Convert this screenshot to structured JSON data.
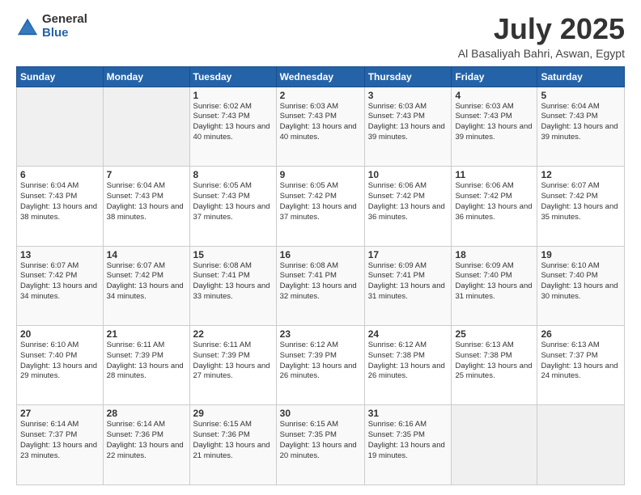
{
  "logo": {
    "general": "General",
    "blue": "Blue"
  },
  "title": "July 2025",
  "location": "Al Basaliyah Bahri, Aswan, Egypt",
  "days_of_week": [
    "Sunday",
    "Monday",
    "Tuesday",
    "Wednesday",
    "Thursday",
    "Friday",
    "Saturday"
  ],
  "weeks": [
    [
      {
        "day": "",
        "info": ""
      },
      {
        "day": "",
        "info": ""
      },
      {
        "day": "1",
        "info": "Sunrise: 6:02 AM\nSunset: 7:43 PM\nDaylight: 13 hours and 40 minutes."
      },
      {
        "day": "2",
        "info": "Sunrise: 6:03 AM\nSunset: 7:43 PM\nDaylight: 13 hours and 40 minutes."
      },
      {
        "day": "3",
        "info": "Sunrise: 6:03 AM\nSunset: 7:43 PM\nDaylight: 13 hours and 39 minutes."
      },
      {
        "day": "4",
        "info": "Sunrise: 6:03 AM\nSunset: 7:43 PM\nDaylight: 13 hours and 39 minutes."
      },
      {
        "day": "5",
        "info": "Sunrise: 6:04 AM\nSunset: 7:43 PM\nDaylight: 13 hours and 39 minutes."
      }
    ],
    [
      {
        "day": "6",
        "info": "Sunrise: 6:04 AM\nSunset: 7:43 PM\nDaylight: 13 hours and 38 minutes."
      },
      {
        "day": "7",
        "info": "Sunrise: 6:04 AM\nSunset: 7:43 PM\nDaylight: 13 hours and 38 minutes."
      },
      {
        "day": "8",
        "info": "Sunrise: 6:05 AM\nSunset: 7:43 PM\nDaylight: 13 hours and 37 minutes."
      },
      {
        "day": "9",
        "info": "Sunrise: 6:05 AM\nSunset: 7:42 PM\nDaylight: 13 hours and 37 minutes."
      },
      {
        "day": "10",
        "info": "Sunrise: 6:06 AM\nSunset: 7:42 PM\nDaylight: 13 hours and 36 minutes."
      },
      {
        "day": "11",
        "info": "Sunrise: 6:06 AM\nSunset: 7:42 PM\nDaylight: 13 hours and 36 minutes."
      },
      {
        "day": "12",
        "info": "Sunrise: 6:07 AM\nSunset: 7:42 PM\nDaylight: 13 hours and 35 minutes."
      }
    ],
    [
      {
        "day": "13",
        "info": "Sunrise: 6:07 AM\nSunset: 7:42 PM\nDaylight: 13 hours and 34 minutes."
      },
      {
        "day": "14",
        "info": "Sunrise: 6:07 AM\nSunset: 7:42 PM\nDaylight: 13 hours and 34 minutes."
      },
      {
        "day": "15",
        "info": "Sunrise: 6:08 AM\nSunset: 7:41 PM\nDaylight: 13 hours and 33 minutes."
      },
      {
        "day": "16",
        "info": "Sunrise: 6:08 AM\nSunset: 7:41 PM\nDaylight: 13 hours and 32 minutes."
      },
      {
        "day": "17",
        "info": "Sunrise: 6:09 AM\nSunset: 7:41 PM\nDaylight: 13 hours and 31 minutes."
      },
      {
        "day": "18",
        "info": "Sunrise: 6:09 AM\nSunset: 7:40 PM\nDaylight: 13 hours and 31 minutes."
      },
      {
        "day": "19",
        "info": "Sunrise: 6:10 AM\nSunset: 7:40 PM\nDaylight: 13 hours and 30 minutes."
      }
    ],
    [
      {
        "day": "20",
        "info": "Sunrise: 6:10 AM\nSunset: 7:40 PM\nDaylight: 13 hours and 29 minutes."
      },
      {
        "day": "21",
        "info": "Sunrise: 6:11 AM\nSunset: 7:39 PM\nDaylight: 13 hours and 28 minutes."
      },
      {
        "day": "22",
        "info": "Sunrise: 6:11 AM\nSunset: 7:39 PM\nDaylight: 13 hours and 27 minutes."
      },
      {
        "day": "23",
        "info": "Sunrise: 6:12 AM\nSunset: 7:39 PM\nDaylight: 13 hours and 26 minutes."
      },
      {
        "day": "24",
        "info": "Sunrise: 6:12 AM\nSunset: 7:38 PM\nDaylight: 13 hours and 26 minutes."
      },
      {
        "day": "25",
        "info": "Sunrise: 6:13 AM\nSunset: 7:38 PM\nDaylight: 13 hours and 25 minutes."
      },
      {
        "day": "26",
        "info": "Sunrise: 6:13 AM\nSunset: 7:37 PM\nDaylight: 13 hours and 24 minutes."
      }
    ],
    [
      {
        "day": "27",
        "info": "Sunrise: 6:14 AM\nSunset: 7:37 PM\nDaylight: 13 hours and 23 minutes."
      },
      {
        "day": "28",
        "info": "Sunrise: 6:14 AM\nSunset: 7:36 PM\nDaylight: 13 hours and 22 minutes."
      },
      {
        "day": "29",
        "info": "Sunrise: 6:15 AM\nSunset: 7:36 PM\nDaylight: 13 hours and 21 minutes."
      },
      {
        "day": "30",
        "info": "Sunrise: 6:15 AM\nSunset: 7:35 PM\nDaylight: 13 hours and 20 minutes."
      },
      {
        "day": "31",
        "info": "Sunrise: 6:16 AM\nSunset: 7:35 PM\nDaylight: 13 hours and 19 minutes."
      },
      {
        "day": "",
        "info": ""
      },
      {
        "day": "",
        "info": ""
      }
    ]
  ]
}
